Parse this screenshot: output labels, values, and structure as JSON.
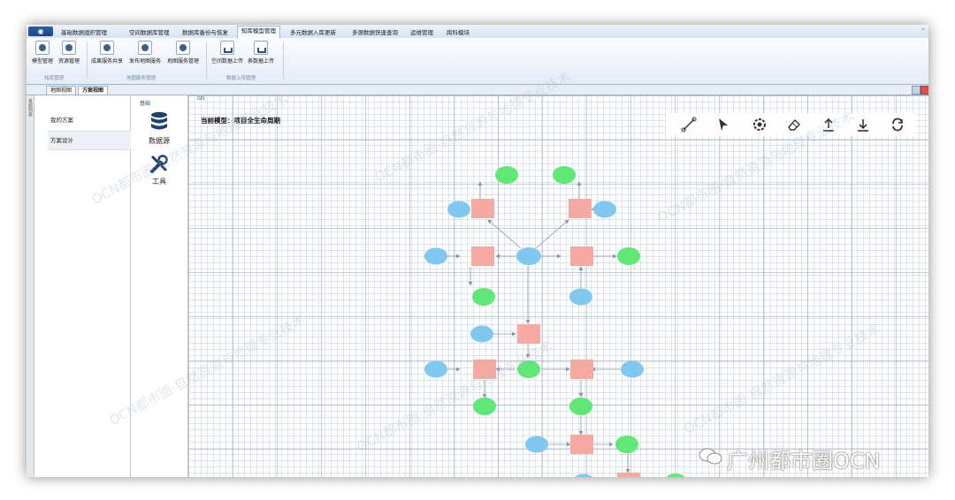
{
  "menu": {
    "items": [
      "基础数据组织管理",
      "空间数据库管理",
      "数据库备份与恢复",
      "知库模型管理",
      "多元数据入库更新",
      "多源数据快速查询",
      "运维管理",
      "跨科模块"
    ],
    "active_index": 3
  },
  "ribbon": {
    "buttons": [
      "模型管理",
      "资源管理",
      "成果服务共享",
      "发布地图服务",
      "地图服务管理",
      "空间数据上传",
      "表数据上传"
    ],
    "groups": [
      "知库管理",
      "地图服务管理",
      "数据上传管理"
    ]
  },
  "tabs": [
    "地图视图",
    "方案视图"
  ],
  "active_tab": 1,
  "side_strip_label": "系统列表",
  "nav": {
    "items": [
      "我的方案",
      "方案设计"
    ],
    "selected_index": 1
  },
  "tools": {
    "title": "基础",
    "items": [
      {
        "label": "数据源",
        "icon": "database-icon"
      },
      {
        "label": "工具",
        "icon": "tools-icon"
      }
    ]
  },
  "canvas": {
    "tag": "GIS",
    "current_model_label": "当前模型：项目全生命周期",
    "toolbar": [
      "connector-line-icon",
      "pointer-arrow-icon",
      "settings-gear-icon",
      "clear-eraser-icon",
      "upload-icon",
      "download-icon",
      "refresh-icon"
    ]
  },
  "watermark": "OCN都市圈·自然资源与地理专业技术",
  "wechat_label": "广州都市圈OCN",
  "colors": {
    "input_node": "#80c8f0",
    "output_node": "#5fe878",
    "tool_node": "#f6a9a0",
    "edge": "#8b96a3",
    "accent": "#2d4f7a"
  }
}
